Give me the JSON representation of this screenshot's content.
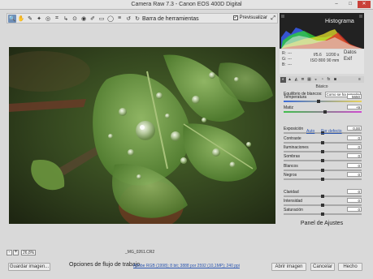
{
  "window": {
    "title": "Camera Raw 7.3  -  Canon EOS 400D Digital",
    "buttons": [
      "–",
      "□",
      "✕"
    ]
  },
  "toolbar": {
    "title": "Barra de herramientas",
    "tools": [
      "zoom-icon",
      "hand-icon",
      "white-balance-icon",
      "color-sampler-icon",
      "target-adjust-icon",
      "crop-icon",
      "straighten-icon",
      "spot-removal-icon",
      "red-eye-icon",
      "adjustment-brush-icon",
      "graduated-filter-icon",
      "radial-filter-icon",
      "preferences-icon",
      "rotate-ccw-icon",
      "rotate-cw-icon"
    ],
    "tool_glyphs": [
      "🔍",
      "✋",
      "✎",
      "✦",
      "◎",
      "⌗",
      "↳",
      "⊙",
      "◉",
      "✐",
      "▭",
      "◯",
      "≡",
      "↺",
      "↻"
    ],
    "preview_label": "Previsualizar",
    "preview_checked": "✓",
    "maximize_glyph": "⤢"
  },
  "histogram": {
    "title": "Histograma",
    "colors": {
      "red": "#e0302c",
      "green": "#2fcf3a",
      "blue": "#3a5df0",
      "yellow": "#e6e02a",
      "white": "#e8e8e8"
    }
  },
  "readout": {
    "r": "R:",
    "g": "G:",
    "b": "B:",
    "r_val": "---",
    "g_val": "---",
    "b_val": "---",
    "aperture": "f/5.6",
    "shutter": "1/200 s",
    "iso": "ISO 800",
    "focal": "90 mm",
    "datos": "Datos",
    "exif": "Exif"
  },
  "panel": {
    "tabs": [
      "◐",
      "▲",
      "◭",
      "≣",
      "▦",
      "◒",
      "◔",
      "fx",
      "◙",
      "≡"
    ],
    "section_title": "Básico",
    "wb_label": "Equilibrio de blancos:",
    "wb_value": "Como se ha tomado",
    "auto_link": "Auto",
    "default_link": "Por defecto",
    "sliders": [
      {
        "label": "Temperatura",
        "value": "5650",
        "position": 0.45
      },
      {
        "label": "Matiz",
        "value": "+9",
        "position": 0.53
      },
      {
        "label": "Exposición",
        "value": "0,00",
        "position": 0.5
      },
      {
        "label": "Contraste",
        "value": "0",
        "position": 0.5
      },
      {
        "label": "Iluminaciones",
        "value": "0",
        "position": 0.5
      },
      {
        "label": "Sombras",
        "value": "0",
        "position": 0.5
      },
      {
        "label": "Blancos",
        "value": "0",
        "position": 0.5
      },
      {
        "label": "Negros",
        "value": "0",
        "position": 0.5
      },
      {
        "label": "Claridad",
        "value": "0",
        "position": 0.5
      },
      {
        "label": "Intensidad",
        "value": "0",
        "position": 0.5
      },
      {
        "label": "Saturación",
        "value": "0",
        "position": 0.5
      }
    ],
    "footer": "Panel de Ajustes"
  },
  "zoom": {
    "minus": "-",
    "plus": "+",
    "level": "26,8%",
    "filename": "_MG_0261.CR2"
  },
  "bottom": {
    "save_button": "Guardar imagen...",
    "workflow_label": "Opciones de flujo de trabajo",
    "workflow_link": "Adobe RGB (1998); 8 bit; 3888 por 2592 (10,1MP); 240 ppi",
    "open_button": "Abrir imagen",
    "cancel_button": "Cancelar",
    "done_button": "Hecho"
  }
}
